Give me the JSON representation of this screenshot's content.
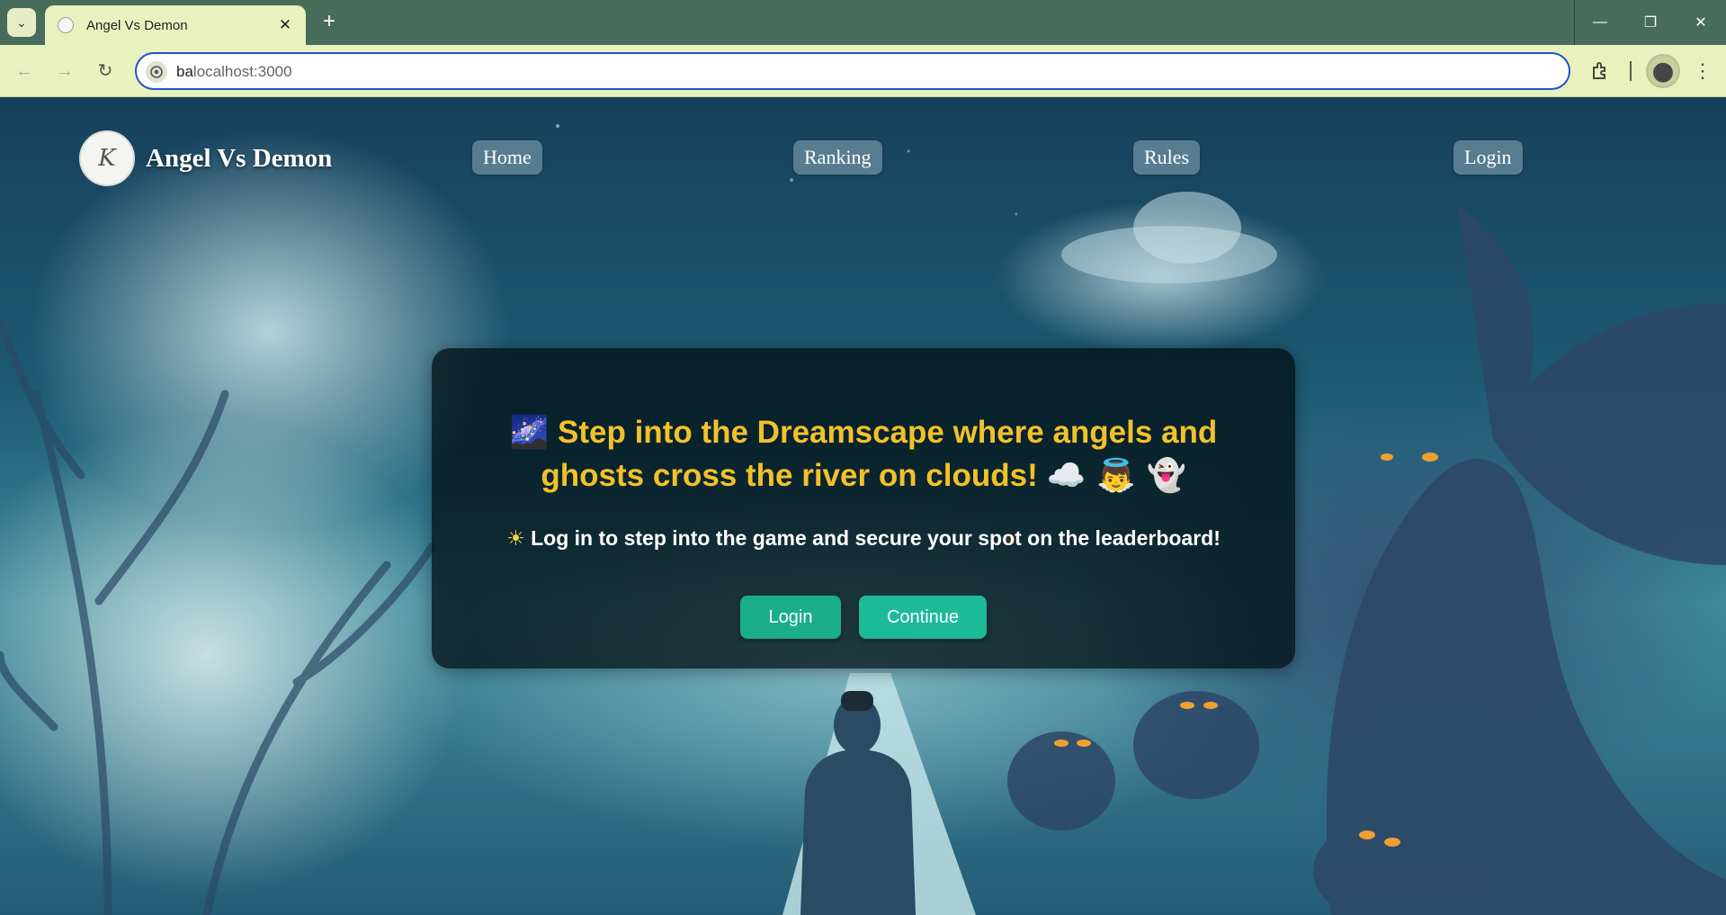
{
  "browser": {
    "tab_title": "Angel Vs Demon",
    "url_typed": "ba",
    "url_suggested": "localhost:3000",
    "window_controls": [
      "minimize",
      "restore",
      "close"
    ]
  },
  "site": {
    "brand": "Angel Vs Demon",
    "logo_letter": "K",
    "nav": {
      "home": "Home",
      "ranking": "Ranking",
      "rules": "Rules",
      "login": "Login"
    }
  },
  "hero": {
    "headline_emoji": "🌌",
    "headline": "Step into the Dreamscape where angels and ghosts cross the river on clouds!",
    "headline_trailing_emojis": "☁️ 👼 👻",
    "sub_emoji": "☀",
    "subtitle": "Log in to step into the game and secure your spot on the leaderboard!",
    "login_button": "Login",
    "continue_button": "Continue"
  },
  "colors": {
    "headline": "#f2c12a",
    "button": "#1aae8c",
    "omnibox_border": "#1a56c9",
    "tabstrip": "#476c5b"
  }
}
